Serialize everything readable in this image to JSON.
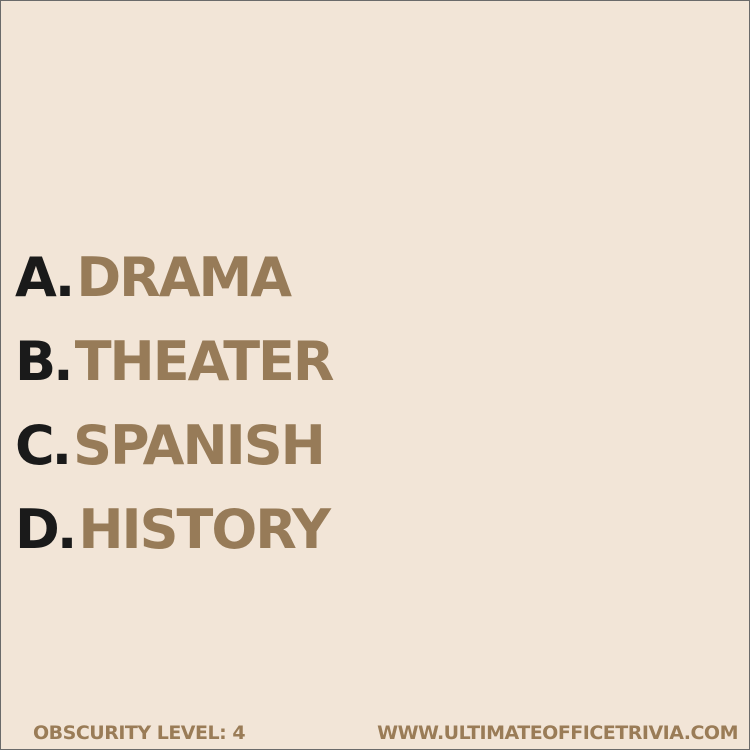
{
  "options": [
    {
      "letter": "A.",
      "text": "DRAMA"
    },
    {
      "letter": "B.",
      "text": "THEATER"
    },
    {
      "letter": "C.",
      "text": "SPANISH"
    },
    {
      "letter": "D.",
      "text": "HISTORY"
    }
  ],
  "footer": {
    "obscurity": "OBSCURITY LEVEL: 4",
    "website": "WWW.ULTIMATEOFFICETRIVIA.COM"
  },
  "colors": {
    "background": "#f2e5d7",
    "answer": "#977b58",
    "letter": "#1a1a1a",
    "footer": "#9a7c57"
  }
}
